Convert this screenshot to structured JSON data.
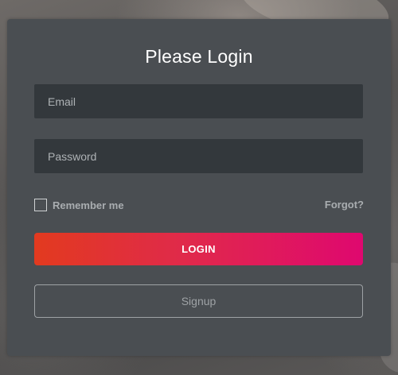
{
  "login_form": {
    "title": "Please Login",
    "email_placeholder": "Email",
    "password_placeholder": "Password",
    "remember_label": "Remember me",
    "remember_checked": false,
    "forgot_link": "Forgot?",
    "login_button": "LOGIN",
    "signup_button": "Signup"
  },
  "colors": {
    "panel_background": "#4a4e52",
    "input_background": "#33383c",
    "login_gradient_start": "#e23a1f",
    "login_gradient_end": "#df086f",
    "muted_text": "#a9adb0"
  }
}
